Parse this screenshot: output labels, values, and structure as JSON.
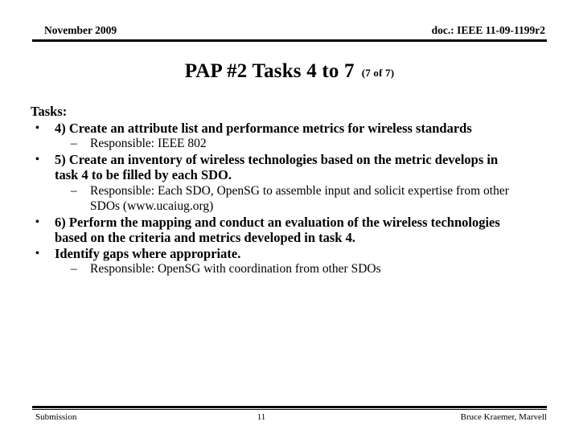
{
  "header": {
    "date": "November 2009",
    "doc_id": "doc.: IEEE 11-09-1199r2"
  },
  "title": {
    "main": "PAP #2 Tasks 4 to 7",
    "counter": "(7 of 7)"
  },
  "body": {
    "lead": "Tasks:",
    "bullet_glyph": "•",
    "dash_glyph": "–",
    "items": [
      {
        "level1": "4) Create an attribute list and performance metrics for wireless standards",
        "level2": [
          "Responsible: IEEE 802"
        ]
      },
      {
        "level1": "5) Create an inventory of wireless technologies based on the metric develops in task 4 to be filled by each SDO.",
        "level2": [
          "Responsible: Each SDO, OpenSG to assemble input and solicit expertise from other SDOs (www.ucaiug.org)"
        ]
      },
      {
        "level1": "6) Perform the mapping and conduct an evaluation of the wireless technologies based on the criteria and metrics developed in task 4.",
        "level2": []
      },
      {
        "level1": "Identify gaps where appropriate.",
        "level2": [
          "Responsible: OpenSG with coordination from other SDOs"
        ]
      }
    ]
  },
  "footer": {
    "left": "Submission",
    "page_number": "11",
    "right": "Bruce Kraemer, Marvell"
  }
}
